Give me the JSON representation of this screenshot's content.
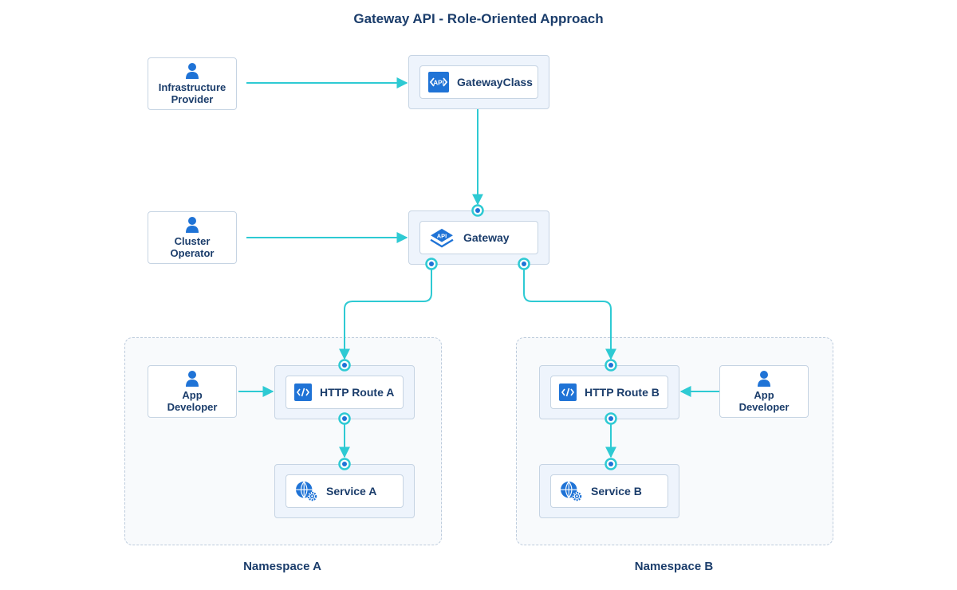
{
  "title": "Gateway API - Role-Oriented Approach",
  "colors": {
    "text": "#1b3d6b",
    "icon_blue": "#1f73d6",
    "connector": "#2ecad3",
    "node_border": "#c6d4e3",
    "node_fill": "#eef4fc",
    "namespace_border": "#bccbdc"
  },
  "actors": {
    "infra": {
      "line1": "Infrastructure",
      "line2": "Provider",
      "icon": "person-icon"
    },
    "cluster": {
      "line1": "Cluster",
      "line2": "Operator",
      "icon": "person-icon"
    },
    "appdev_a": {
      "line1": "App",
      "line2": "Developer",
      "icon": "person-icon"
    },
    "appdev_b": {
      "line1": "App",
      "line2": "Developer",
      "icon": "person-icon"
    }
  },
  "resources": {
    "gatewayclass": {
      "label": "GatewayClass",
      "icon": "api-code-icon"
    },
    "gateway": {
      "label": "Gateway",
      "icon": "api-layers-icon"
    },
    "route_a": {
      "label": "HTTP Route A",
      "icon": "code-icon"
    },
    "route_b": {
      "label": "HTTP Route B",
      "icon": "code-icon"
    },
    "service_a": {
      "label": "Service A",
      "icon": "globe-gear-icon"
    },
    "service_b": {
      "label": "Service B",
      "icon": "globe-gear-icon"
    }
  },
  "namespaces": {
    "a": {
      "label": "Namespace A"
    },
    "b": {
      "label": "Namespace B"
    }
  },
  "connections": [
    {
      "from": "Infrastructure Provider",
      "to": "GatewayClass"
    },
    {
      "from": "GatewayClass",
      "to": "Gateway"
    },
    {
      "from": "Cluster Operator",
      "to": "Gateway"
    },
    {
      "from": "Gateway",
      "to": "HTTP Route A"
    },
    {
      "from": "Gateway",
      "to": "HTTP Route B"
    },
    {
      "from": "App Developer",
      "to": "HTTP Route A"
    },
    {
      "from": "App Developer",
      "to": "HTTP Route B"
    },
    {
      "from": "HTTP Route A",
      "to": "Service A"
    },
    {
      "from": "HTTP Route B",
      "to": "Service B"
    }
  ]
}
